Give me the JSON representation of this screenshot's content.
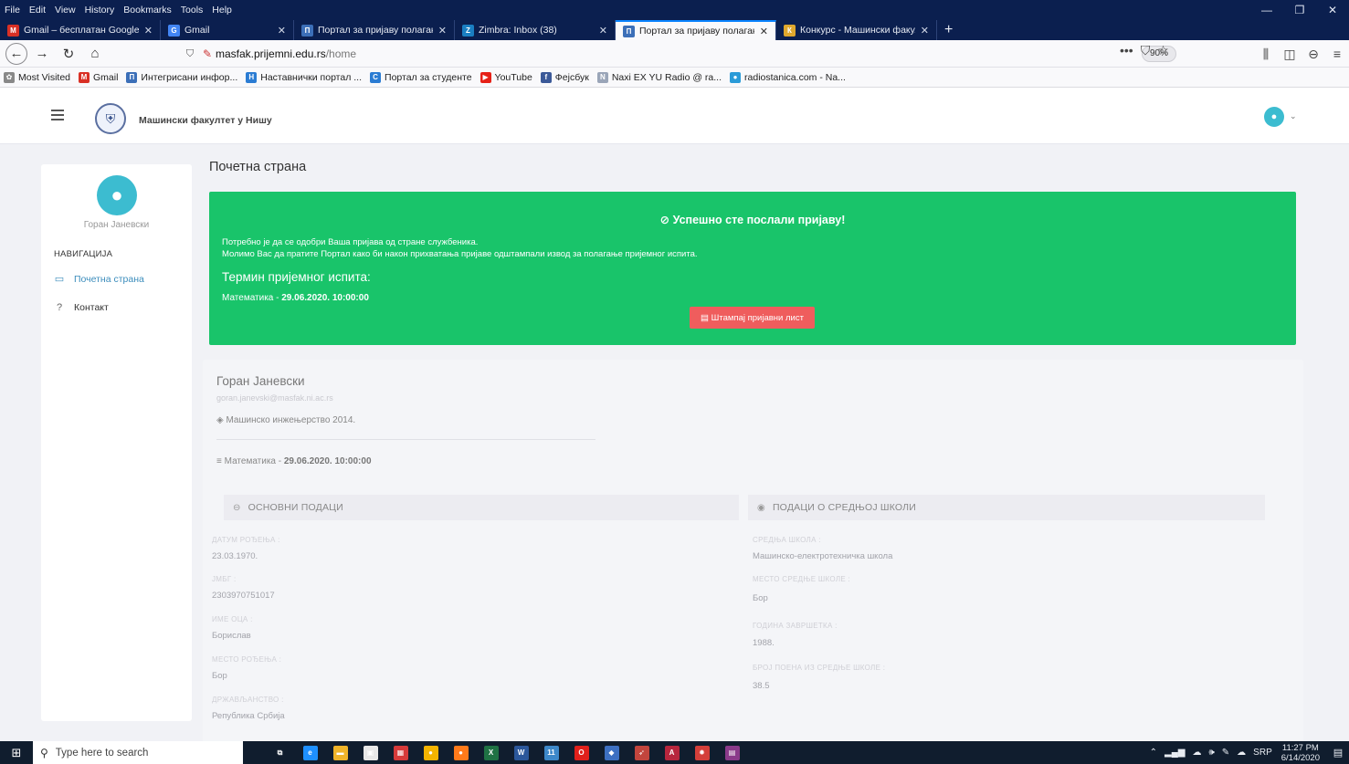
{
  "browser": {
    "menu": [
      "File",
      "Edit",
      "View",
      "History",
      "Bookmarks",
      "Tools",
      "Help"
    ],
    "window_controls": [
      "—",
      "❐",
      "✕"
    ],
    "tabs": [
      {
        "title": "Gmail – бесплатан Google ме",
        "icon": "M",
        "icon_color": "#d93025",
        "width": 176
      },
      {
        "title": "Gmail",
        "icon": "G",
        "icon_color": "#4285f4",
        "width": 146
      },
      {
        "title": "Портал за пријаву полагања",
        "icon": "П",
        "icon_color": "#3c6fb8",
        "width": 176
      },
      {
        "title": "Zimbra: Inbox (38)",
        "icon": "Z",
        "icon_color": "#1a7fc2",
        "width": 176
      },
      {
        "title": "Портал за пријаву полагања",
        "icon": "П",
        "icon_color": "#3c6fb8",
        "width": 176,
        "active": true
      },
      {
        "title": "Конкурс - Машински факулт",
        "icon": "К",
        "icon_color": "#e0a82e",
        "width": 176
      }
    ],
    "new_tab": "+",
    "url_host": "masfak.prijemni.edu.rs",
    "url_path": "/home",
    "zoom": "90%",
    "url_actions": [
      "•••",
      "☆"
    ],
    "bookmarks": [
      {
        "label": "Most Visited",
        "icon": "✿",
        "color": "#888"
      },
      {
        "label": "Gmail",
        "icon": "M",
        "color": "#d93025"
      },
      {
        "label": "Интегрисани инфор...",
        "icon": "П",
        "color": "#3c6fb8"
      },
      {
        "label": "Наставнички портал ...",
        "icon": "Н",
        "color": "#2b7cd3"
      },
      {
        "label": "Портал за студенте",
        "icon": "С",
        "color": "#2b7cd3"
      },
      {
        "label": "YouTube",
        "icon": "▶",
        "color": "#e62117"
      },
      {
        "label": "Фејсбук",
        "icon": "f",
        "color": "#3b5998"
      },
      {
        "label": "Naxi EX YU Radio @ ra...",
        "icon": "N",
        "color": "#9aa5b8"
      },
      {
        "label": "radiostanica.com - Na...",
        "icon": "●",
        "color": "#2b9bd8"
      }
    ]
  },
  "app": {
    "brand": "Машински факултет у Нишу",
    "sidebar": {
      "user_name": "Горан Јаневски",
      "nav_heading": "НАВИГАЦИЈА",
      "items": [
        {
          "label": "Почетна страна",
          "icon": "▭",
          "active": true
        },
        {
          "label": "Контакт",
          "icon": "?"
        }
      ]
    },
    "page_title": "Почетна страна",
    "alert": {
      "title": "Успешно сте послали пријаву!",
      "line1": "Потребно је да се одобри Ваша пријава од стране службеника.",
      "line2": "Молимо Вас да пратите Портал како би након прихватања пријаве одштампали извод за полагање пријемног испита.",
      "term_heading": "Термин пријемног испита:",
      "exam_subject": "Математика - ",
      "exam_datetime": "29.06.2020. 10:00:00",
      "print_button": "Штампај пријавни лист"
    },
    "profile": {
      "name": "Горан Јаневски",
      "email": "goran.janevski@masfak.ni.ac.rs",
      "program": "Машинско инжењерство 2014.",
      "exam_subject": "Математика - ",
      "exam_datetime": "29.06.2020. 10:00:00",
      "basic": {
        "heading": "ОСНОВНИ ПОДАЦИ",
        "fields": [
          {
            "label": "ДАТУМ РОЂЕЊА :",
            "value": "23.03.1970."
          },
          {
            "label": "ЈМБГ :",
            "value": "2303970751017"
          },
          {
            "label": "ИМЕ ОЦА :",
            "value": "Борислав"
          },
          {
            "label": "МЕСТО РОЂЕЊА :",
            "value": "Бор"
          },
          {
            "label": "ДРЖАВЉАНСТВО :",
            "value": "Република Србија"
          }
        ]
      },
      "school": {
        "heading": "ПОДАЦИ О СРЕДЊОЈ ШКОЛИ",
        "fields": [
          {
            "label": "СРЕДЊА ШКОЛА :",
            "value": "Машинско-електротехничка школа"
          },
          {
            "label": "МЕСТО СРЕДЊЕ ШКОЛЕ :",
            "value": "Бор"
          },
          {
            "label": "ГОДИНА ЗАВРШЕТКА :",
            "value": "1988."
          },
          {
            "label": "БРОЈ ПОЕНА ИЗ СРЕДЊЕ ШКОЛЕ :",
            "value": "38.5"
          }
        ]
      }
    }
  },
  "taskbar": {
    "search_placeholder": "Type here to search",
    "apps": [
      {
        "name": "task-view",
        "glyph": "⧉",
        "color": "#101d2e"
      },
      {
        "name": "edge",
        "glyph": "e",
        "color": "#1e90ff"
      },
      {
        "name": "file-explorer",
        "glyph": "▬",
        "color": "#f0b429"
      },
      {
        "name": "store",
        "glyph": "▣",
        "color": "#e8e8e8"
      },
      {
        "name": "app-red",
        "glyph": "▦",
        "color": "#d63a3a"
      },
      {
        "name": "chrome",
        "glyph": "●",
        "color": "#f4b400"
      },
      {
        "name": "firefox",
        "glyph": "●",
        "color": "#ff7a1a"
      },
      {
        "name": "excel",
        "glyph": "X",
        "color": "#1f7244"
      },
      {
        "name": "word",
        "glyph": "W",
        "color": "#2b579a"
      },
      {
        "name": "mail",
        "glyph": "11",
        "color": "#3d88c9"
      },
      {
        "name": "opera",
        "glyph": "O",
        "color": "#e0201b"
      },
      {
        "name": "app-blue",
        "glyph": "◆",
        "color": "#3d70c2"
      },
      {
        "name": "app-rocket",
        "glyph": "➶",
        "color": "#c2453d"
      },
      {
        "name": "access",
        "glyph": "A",
        "color": "#b7263d"
      },
      {
        "name": "app-gear",
        "glyph": "✹",
        "color": "#d43f3a"
      },
      {
        "name": "winrar",
        "glyph": "▤",
        "color": "#8a3a8a"
      }
    ],
    "language": "SRP",
    "time": "11:27 PM",
    "date": "6/14/2020"
  }
}
